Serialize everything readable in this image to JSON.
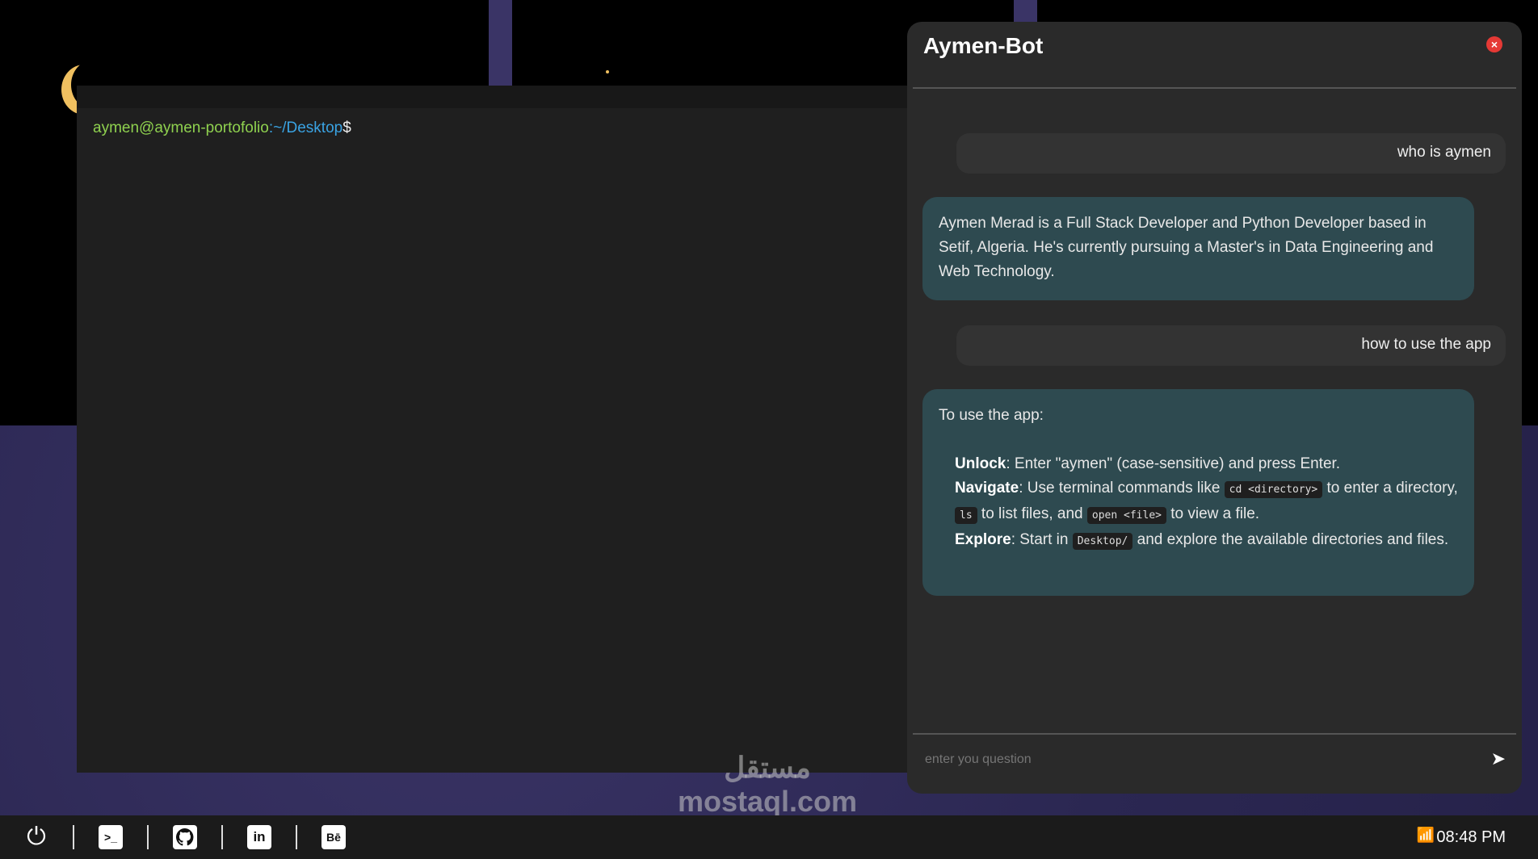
{
  "terminal": {
    "user": "aymen@aymen-portofolio",
    "path": ":~/Desktop",
    "sign": "$"
  },
  "chat": {
    "title": "Aymen-Bot",
    "messages": [
      {
        "role": "user",
        "text": "who is aymen"
      },
      {
        "role": "bot",
        "text": "Aymen Merad is a Full Stack Developer and Python Developer based in Setif, Algeria. He's currently pursuing a Master's in Data Engineering and Web Technology."
      },
      {
        "role": "user",
        "text": "how to use the app"
      }
    ],
    "howto": {
      "intro": "To use the app:",
      "unlock_label": "Unlock",
      "unlock_text": ": Enter \"aymen\" (case-sensitive) and press Enter.",
      "nav_label": "Navigate",
      "nav_t1": ": Use terminal commands like ",
      "nav_c1": "cd <directory>",
      "nav_t2": " to enter a directory, ",
      "nav_c2": "ls",
      "nav_t3": " to list files, and ",
      "nav_c3": "open <file>",
      "nav_t4": " to view a file.",
      "explore_label": "Explore",
      "explore_t1": ": Start in ",
      "explore_c1": "Desktop/",
      "explore_t2": " and explore the available directories and files."
    },
    "input_placeholder": "enter you question"
  },
  "taskbar": {
    "time": "08:48 PM",
    "icons": [
      "power-icon",
      "terminal-icon",
      "github-icon",
      "linkedin-icon",
      "behance-icon"
    ]
  },
  "watermark": {
    "text": "mostaql.com",
    "arabic": "مستقل"
  }
}
